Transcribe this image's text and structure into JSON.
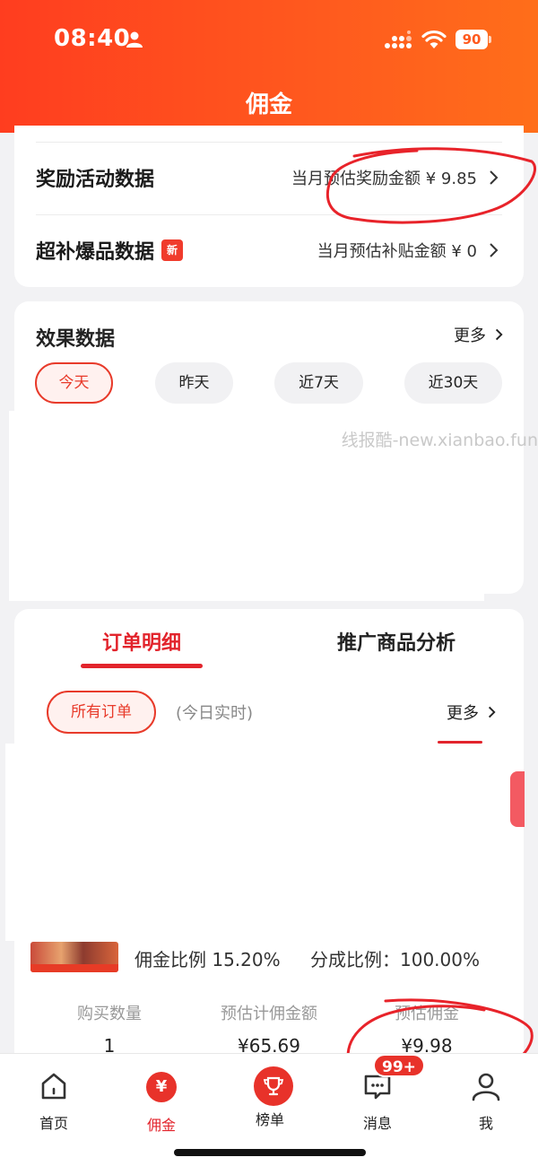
{
  "status_bar": {
    "time": "08:40",
    "battery": "90"
  },
  "header": {
    "title": "佣金"
  },
  "stats_rows": [
    {
      "title": "奖励活动数据",
      "value": "当月预估奖励金额 ¥ 9.85",
      "badge": ""
    },
    {
      "title": "超补爆品数据",
      "value": "当月预估补贴金额 ¥ 0",
      "badge": "新"
    }
  ],
  "effect": {
    "title": "效果数据",
    "more": "更多",
    "filters": [
      "今天",
      "昨天",
      "近7天",
      "近30天"
    ],
    "active_filter": "今天",
    "watermark": "线报酷-new.xianbao.fun"
  },
  "orders": {
    "tabs": [
      "订单明细",
      "推广商品分析"
    ],
    "active_tab": "订单明细",
    "filter": "所有订单",
    "realtime_note": "(今日实时)",
    "more": "更多",
    "product": {
      "commission_rate": "佣金比例 15.20%",
      "split_rate": "分成比例：100.00%"
    },
    "columns": [
      {
        "label": "购买数量",
        "value": "1"
      },
      {
        "label": "预估计佣金额",
        "value": "¥65.69"
      },
      {
        "label": "预估佣金",
        "value": "¥9.98"
      }
    ]
  },
  "tabbar": {
    "items": [
      {
        "label": "首页",
        "icon": "home-icon"
      },
      {
        "label": "佣金",
        "icon": "yen-icon"
      },
      {
        "label": "榜单",
        "icon": "trophy-icon"
      },
      {
        "label": "消息",
        "icon": "message-icon"
      },
      {
        "label": "我",
        "icon": "person-icon"
      }
    ],
    "active": "佣金",
    "message_badge": "99+"
  },
  "colors": {
    "brand": "#ff4a1f",
    "accent_red": "#e2242c",
    "annotation": "#e8232a"
  }
}
